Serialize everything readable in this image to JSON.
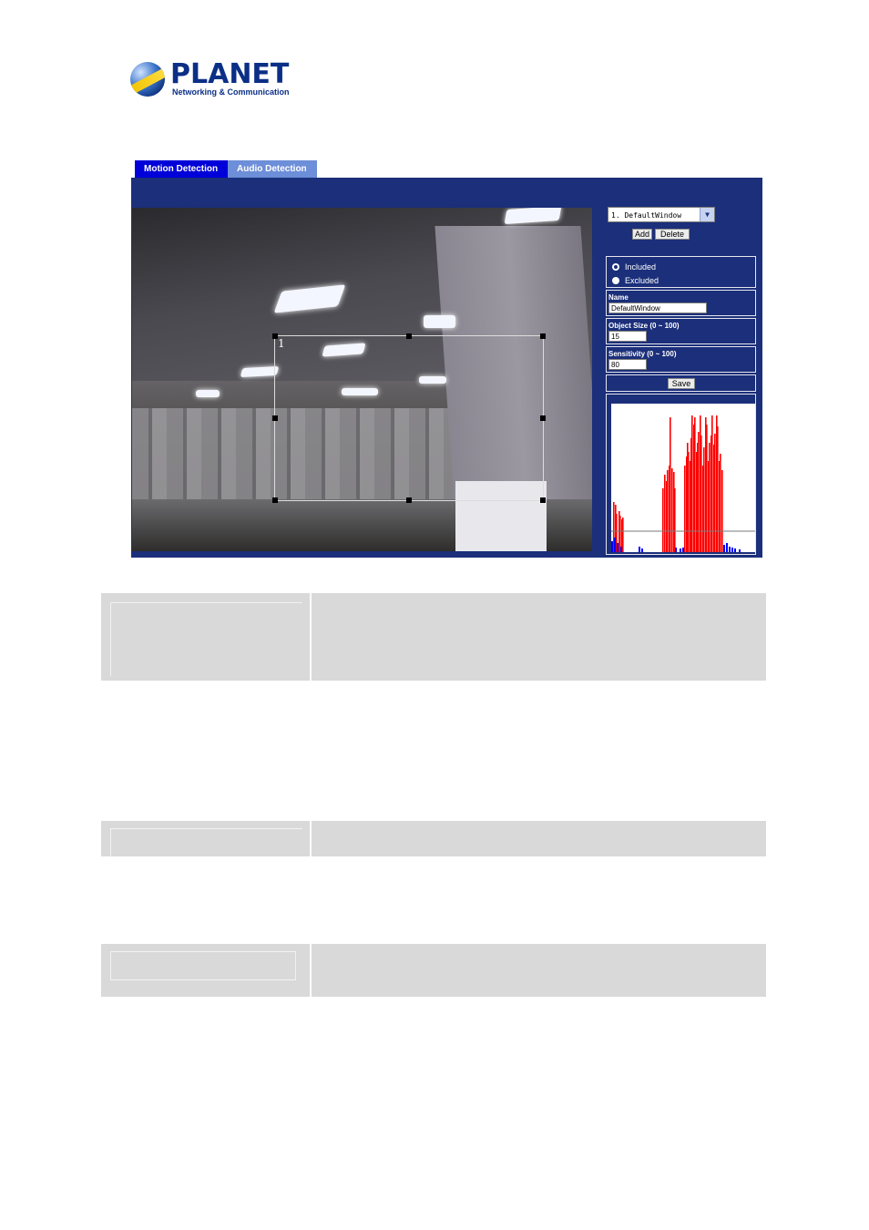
{
  "logo": {
    "brand": "PLANET",
    "tagline": "Networking & Communication"
  },
  "tabs": [
    {
      "label": "Motion Detection",
      "active": true
    },
    {
      "label": "Audio Detection",
      "active": false
    }
  ],
  "window_select": {
    "selected": "1. DefaultWindow"
  },
  "buttons": {
    "add": "Add",
    "delete": "Delete",
    "save": "Save"
  },
  "mode": {
    "included": {
      "label": "Included",
      "checked": true
    },
    "excluded": {
      "label": "Excluded",
      "checked": false
    }
  },
  "name": {
    "label": "Name",
    "value": "DefaultWindow"
  },
  "object_size": {
    "label": "Object Size   (0 ~ 100)",
    "value": "15"
  },
  "sensitivity": {
    "label": "Sensitivity   (0 ~ 100)",
    "value": "80"
  },
  "region": {
    "label": "1"
  },
  "colors": {
    "panel": "#1b2f7a",
    "tab_active": "#0000d8",
    "tab_inactive": "#6d8ed8",
    "histogram_alert": "#ff0000",
    "histogram_level": "#0000ff"
  }
}
